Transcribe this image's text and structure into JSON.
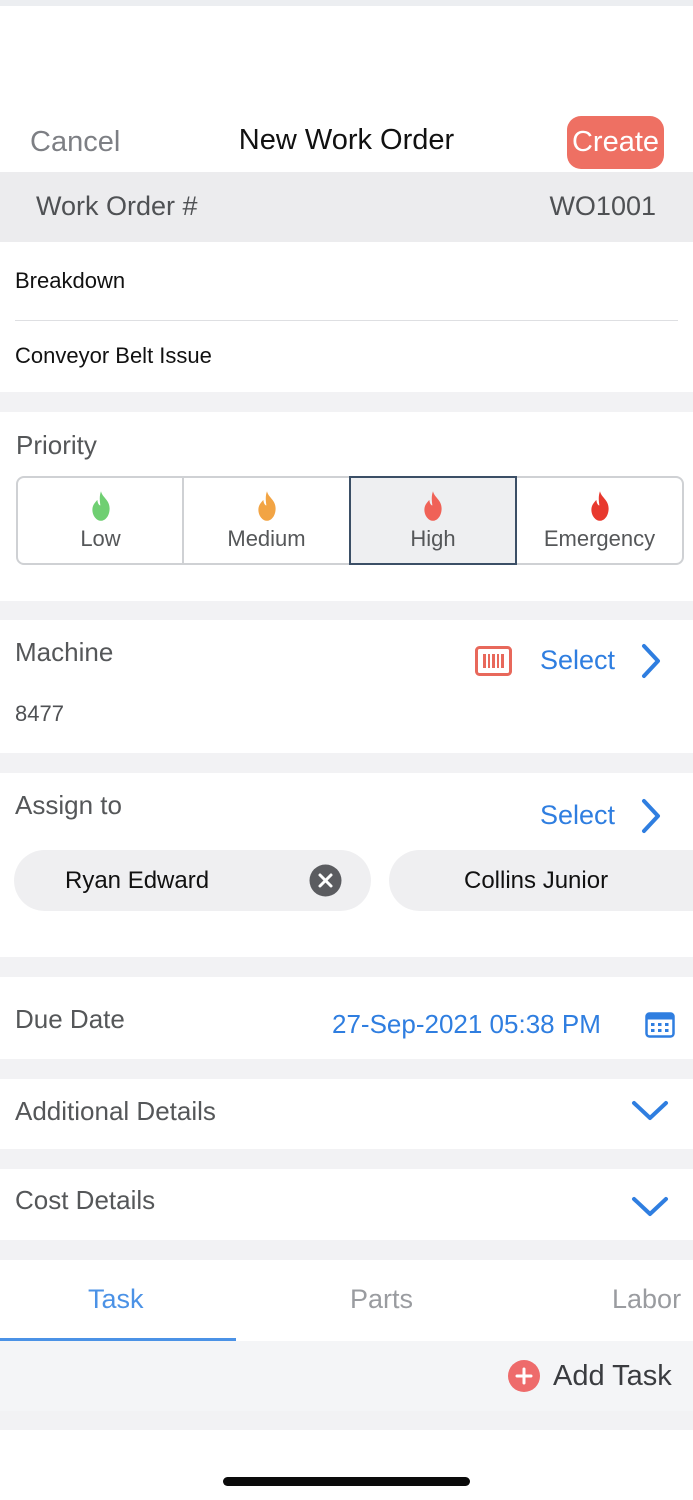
{
  "header": {
    "cancel_label": "Cancel",
    "title": "New Work Order",
    "create_label": "Create"
  },
  "work_order": {
    "label": "Work Order #",
    "value": "WO1001"
  },
  "fields": {
    "type": "Breakdown",
    "title": "Conveyor Belt Issue"
  },
  "priority": {
    "label": "Priority",
    "selected": "High",
    "options": [
      {
        "label": "Low",
        "color": "#6fcf72"
      },
      {
        "label": "Medium",
        "color": "#f2a444"
      },
      {
        "label": "High",
        "color": "#f06257"
      },
      {
        "label": "Emergency",
        "color": "#e8392e"
      }
    ]
  },
  "machine": {
    "label": "Machine",
    "select_label": "Select",
    "value": "8477",
    "scan_icon": "barcode-icon"
  },
  "assign": {
    "label": "Assign to",
    "select_label": "Select",
    "assignees": [
      "Ryan Edward",
      "Collins Junior"
    ]
  },
  "due_date": {
    "label": "Due Date",
    "value": "27-Sep-2021 05:38 PM",
    "icon": "calendar-icon"
  },
  "additional_details": {
    "label": "Additional Details"
  },
  "cost_details": {
    "label": "Cost Details"
  },
  "tabs": {
    "active": "Task",
    "items": [
      {
        "label": "Task"
      },
      {
        "label": "Parts"
      },
      {
        "label": "Labor"
      }
    ]
  },
  "add_task": {
    "label": "Add Task"
  },
  "colors": {
    "accent": "#2f7ee0",
    "create": "#ee7063",
    "add_icon": "#ee6b6b"
  }
}
